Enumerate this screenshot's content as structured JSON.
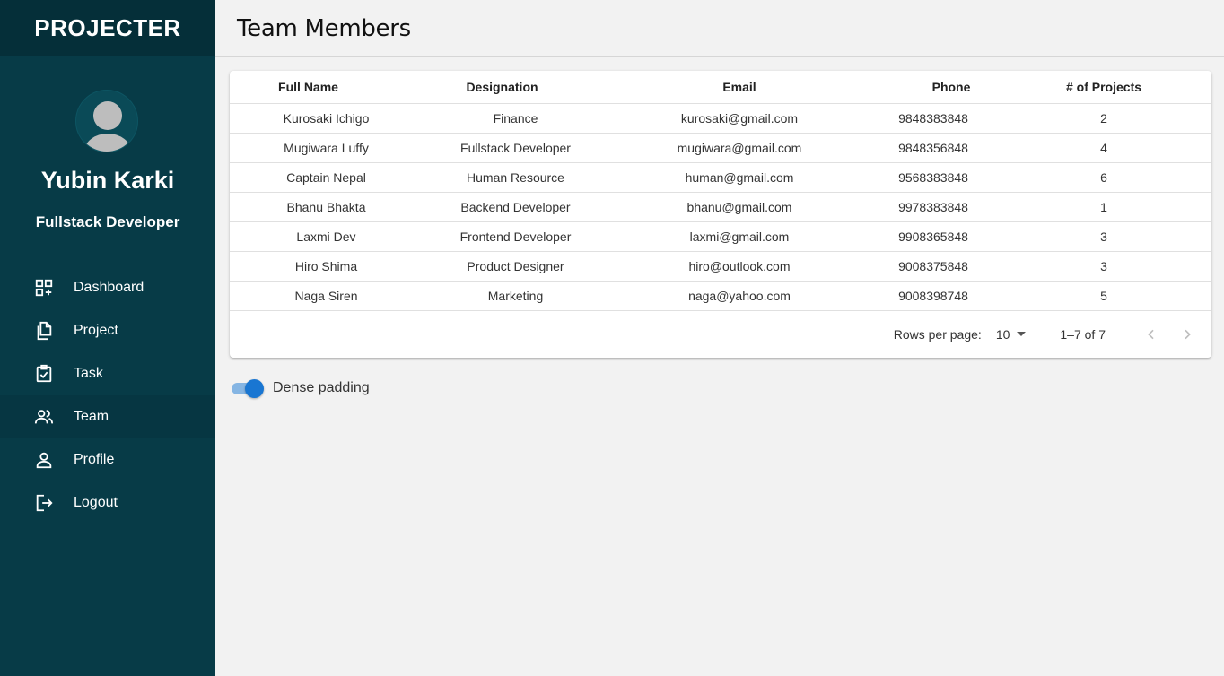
{
  "brand": "PROJECTER",
  "user": {
    "name": "Yubin Karki",
    "role": "Fullstack Developer"
  },
  "nav": [
    {
      "label": "Dashboard",
      "icon": "dashboard-icon"
    },
    {
      "label": "Project",
      "icon": "files-icon"
    },
    {
      "label": "Task",
      "icon": "clipboard-check-icon"
    },
    {
      "label": "Team",
      "icon": "team-icon",
      "active": true
    },
    {
      "label": "Profile",
      "icon": "user-icon"
    },
    {
      "label": "Logout",
      "icon": "logout-icon"
    }
  ],
  "header": {
    "title": "Team Members"
  },
  "table": {
    "columns": [
      "Full Name",
      "Designation",
      "Email",
      "Phone",
      "# of Projects"
    ],
    "rows": [
      [
        "Kurosaki Ichigo",
        "Finance",
        "kurosaki@gmail.com",
        "9848383848",
        "2"
      ],
      [
        "Mugiwara Luffy",
        "Fullstack Developer",
        "mugiwara@gmail.com",
        "9848356848",
        "4"
      ],
      [
        "Captain Nepal",
        "Human Resource",
        "human@gmail.com",
        "9568383848",
        "6"
      ],
      [
        "Bhanu Bhakta",
        "Backend Developer",
        "bhanu@gmail.com",
        "9978383848",
        "1"
      ],
      [
        "Laxmi Dev",
        "Frontend Developer",
        "laxmi@gmail.com",
        "9908365848",
        "3"
      ],
      [
        "Hiro Shima",
        "Product Designer",
        "hiro@outlook.com",
        "9008375848",
        "3"
      ],
      [
        "Naga Siren",
        "Marketing",
        "naga@yahoo.com",
        "9008398748",
        "5"
      ]
    ]
  },
  "pagination": {
    "rows_per_page_label": "Rows per page:",
    "rows_per_page": "10",
    "range": "1–7 of 7"
  },
  "dense_padding": {
    "label": "Dense padding",
    "checked": true
  },
  "colors": {
    "sidebar": "#073b47",
    "brand_bar": "#052f39",
    "accent": "#1976d2",
    "background": "#f2f2f2"
  }
}
